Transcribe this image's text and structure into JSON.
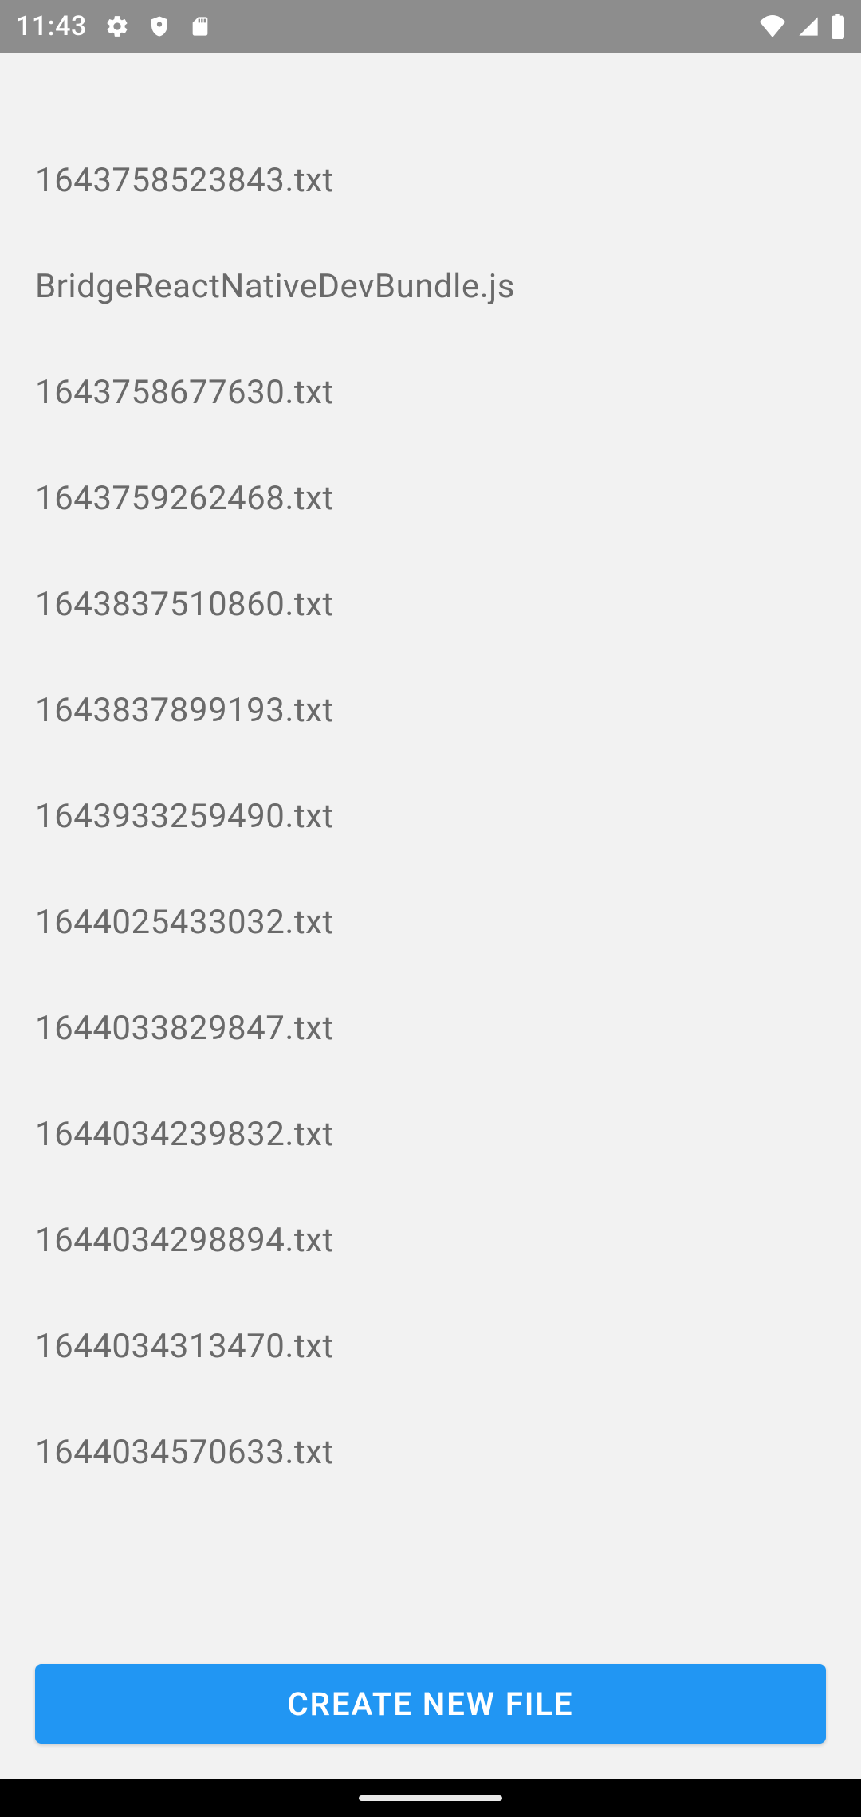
{
  "status": {
    "time": "11:43"
  },
  "files": [
    {
      "name": "1643758523843.txt"
    },
    {
      "name": "BridgeReactNativeDevBundle.js"
    },
    {
      "name": "1643758677630.txt"
    },
    {
      "name": "1643759262468.txt"
    },
    {
      "name": "1643837510860.txt"
    },
    {
      "name": "1643837899193.txt"
    },
    {
      "name": "1643933259490.txt"
    },
    {
      "name": "1644025433032.txt"
    },
    {
      "name": "1644033829847.txt"
    },
    {
      "name": "1644034239832.txt"
    },
    {
      "name": "1644034298894.txt"
    },
    {
      "name": "1644034313470.txt"
    },
    {
      "name": "1644034570633.txt"
    }
  ],
  "actions": {
    "create_label": "CREATE NEW FILE"
  }
}
